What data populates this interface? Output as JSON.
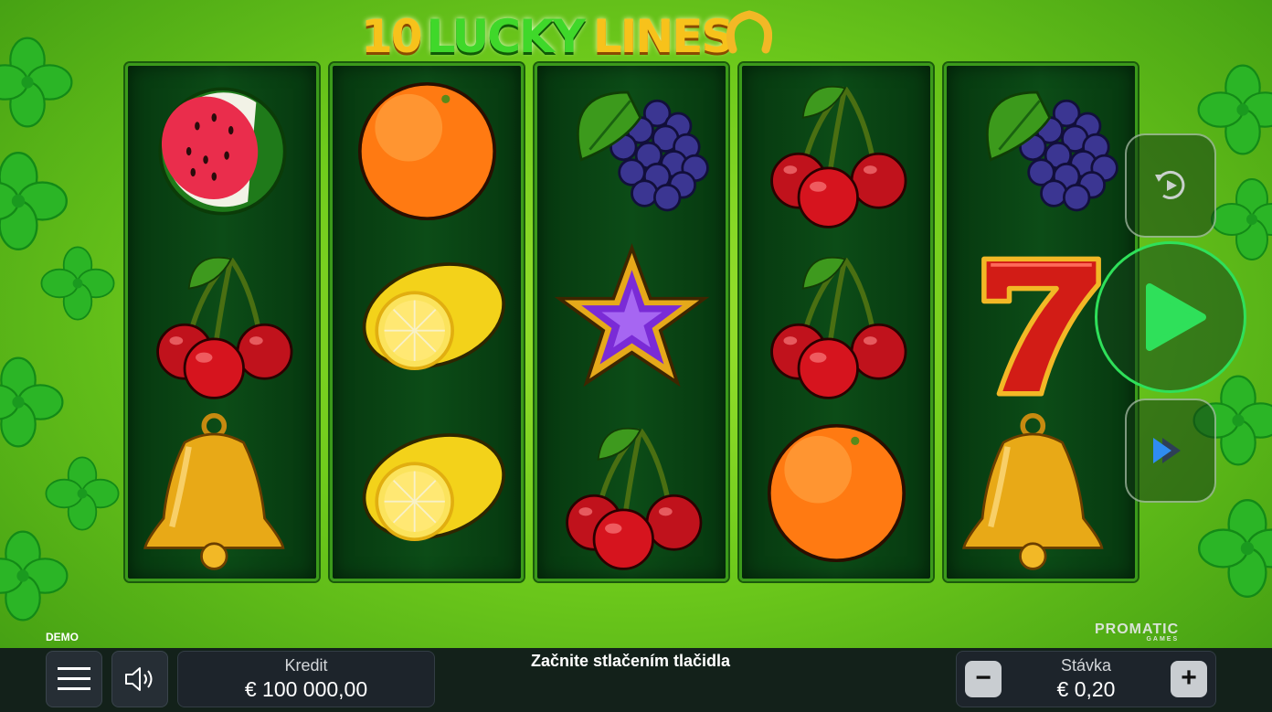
{
  "title": {
    "number": "10",
    "word1": "LUCKY",
    "word2": "LINES"
  },
  "reels": [
    [
      "watermelon",
      "cherries",
      "bell"
    ],
    [
      "orange",
      "lemon",
      "lemon"
    ],
    [
      "grapes",
      "star",
      "cherries"
    ],
    [
      "cherries",
      "cherries",
      "orange"
    ],
    [
      "grapes",
      "seven",
      "bell"
    ]
  ],
  "controls": {
    "autoplay_icon": "autoplay-icon",
    "spin_icon": "play-icon",
    "turbo_icon": "fast-forward-icon"
  },
  "footer": {
    "demo_label": "DEMO",
    "brand": "PROMATIC",
    "brand_sub": "GAMES",
    "credit_label": "Kredit",
    "credit_value": "€ 100 000,00",
    "message": "Začnite stlačením tlačidla",
    "bet_label": "Stávka",
    "bet_value": "€ 0,20",
    "minus": "−",
    "plus": "+"
  },
  "colors": {
    "accent": "#2fe05a",
    "background": "#6fcb1c",
    "reel_bg": "#0c4c17",
    "bar": "#13211a"
  }
}
